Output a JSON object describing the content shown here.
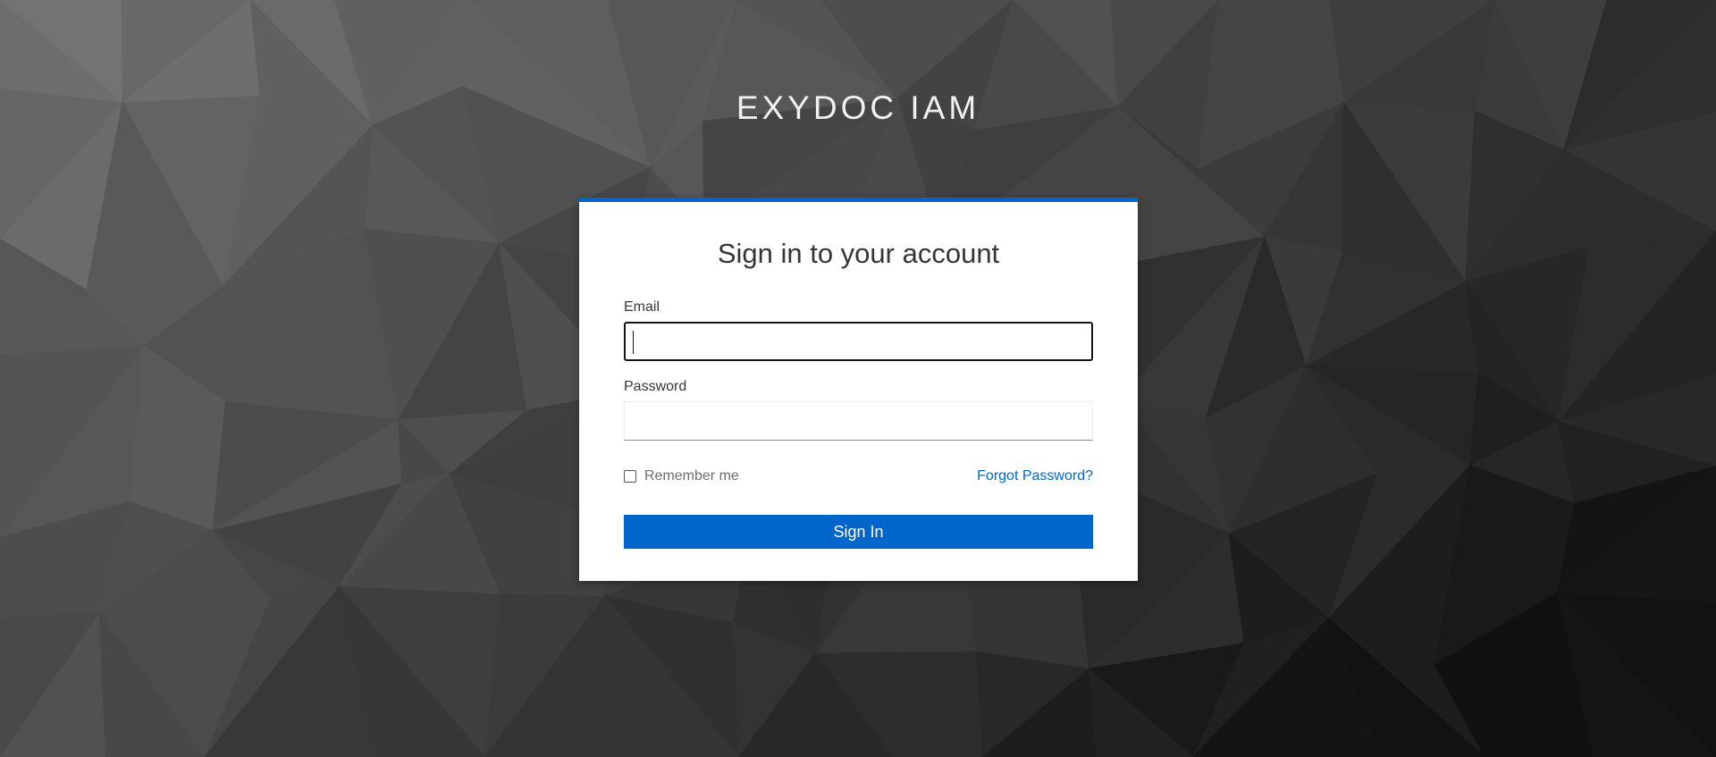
{
  "realm": {
    "title": "EXYDOC IAM"
  },
  "login": {
    "heading": "Sign in to your account",
    "email_label": "Email",
    "email_value": "",
    "password_label": "Password",
    "password_value": "",
    "remember_label": "Remember me",
    "remember_checked": false,
    "forgot_label": "Forgot Password?",
    "submit_label": "Sign In"
  },
  "colors": {
    "accent": "#0066cc",
    "card_background": "#ffffff",
    "text_primary": "#363636",
    "text_muted": "#6a6e73"
  }
}
